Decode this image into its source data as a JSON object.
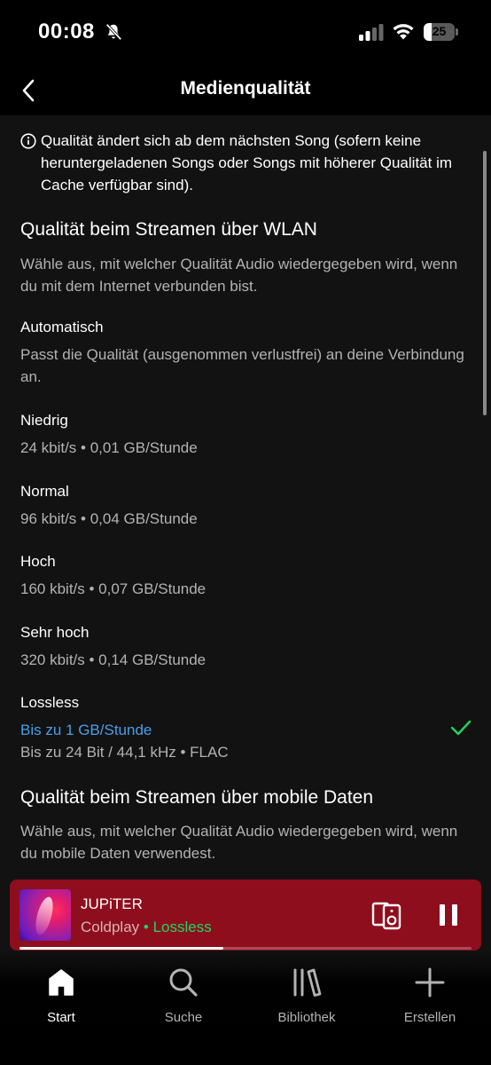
{
  "status_bar": {
    "time": "00:08",
    "battery": "25",
    "icons": [
      "bell-slash-icon",
      "signal-icon",
      "wifi-icon",
      "battery-icon"
    ]
  },
  "header": {
    "title": "Medienqualität",
    "back_icon": "chevron-left-icon"
  },
  "info_notice": {
    "icon": "info-icon",
    "text": "Qualität ändert sich ab dem nächsten Song (sofern keine heruntergeladenen Songs oder Songs mit höherer Qualität im Cache verfügbar sind)."
  },
  "wifi_section": {
    "title": "Qualität beim Streamen über WLAN",
    "description": "Wähle aus, mit welcher Qualität Audio wiedergegeben wird, wenn du mit dem Internet verbunden bist.",
    "options": [
      {
        "name": "Automatisch",
        "detail": "Passt die Qualität (ausgenommen verlustfrei) an deine Verbindung an."
      },
      {
        "name": "Niedrig",
        "detail": "24 kbit/s • 0,01 GB/Stunde"
      },
      {
        "name": "Normal",
        "detail": "96 kbit/s • 0,04 GB/Stunde"
      },
      {
        "name": "Hoch",
        "detail": "160 kbit/s • 0,07 GB/Stunde"
      },
      {
        "name": "Sehr hoch",
        "detail": "320 kbit/s • 0,14 GB/Stunde"
      },
      {
        "name": "Lossless",
        "detail_highlight": "Bis zu 1 GB/Stunde",
        "detail": "Bis zu 24 Bit / 44,1 kHz • FLAC",
        "selected": true
      }
    ]
  },
  "mobile_section": {
    "title": "Qualität beim Streamen über mobile Daten",
    "description": "Wähle aus, mit welcher Qualität Audio wiedergegeben wird, wenn du mobile Daten verwendest."
  },
  "mini_player": {
    "title": "JUPiTER",
    "artist": "Coldplay",
    "separator": " • ",
    "quality": "Lossless",
    "progress": 0.45,
    "background_color": "#8e0e1d",
    "icons": [
      "connect-device-icon",
      "pause-icon"
    ]
  },
  "bottom_nav": {
    "items": [
      {
        "label": "Start",
        "icon": "home-icon",
        "active": true
      },
      {
        "label": "Suche",
        "icon": "search-icon",
        "active": false
      },
      {
        "label": "Bibliothek",
        "icon": "library-icon",
        "active": false
      },
      {
        "label": "Erstellen",
        "icon": "plus-icon",
        "active": false
      }
    ]
  },
  "colors": {
    "background": "#121212",
    "accent_green": "#1ed760",
    "link_blue": "#4a9fe8",
    "secondary_text": "#b3b3b3"
  }
}
